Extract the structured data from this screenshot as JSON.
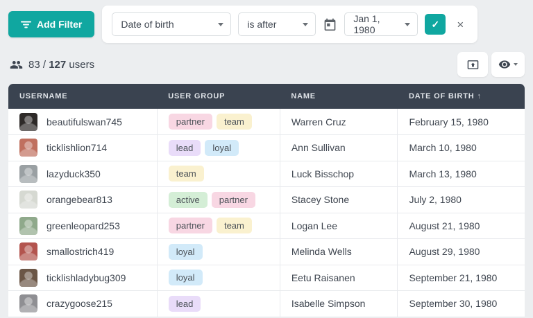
{
  "filter_bar": {
    "add_filter_label": "Add Filter",
    "field_selected": "Date of birth",
    "operator_selected": "is after",
    "value_selected": "Jan 1, 1980",
    "apply_glyph": "✓",
    "remove_glyph": "×"
  },
  "toolbar": {
    "count_current": "83",
    "count_separator": " / ",
    "count_total": "127",
    "count_suffix": " users"
  },
  "table": {
    "columns": [
      {
        "label": "USERNAME",
        "sort": ""
      },
      {
        "label": "USER GROUP",
        "sort": ""
      },
      {
        "label": "NAME",
        "sort": ""
      },
      {
        "label": "DATE OF BIRTH",
        "sort": "↑"
      }
    ],
    "rows": [
      {
        "username": "beautifulswan745",
        "avatar_color": "#2e2a28",
        "groups": [
          "partner",
          "team"
        ],
        "name": "Warren Cruz",
        "dob": "February 15, 1980"
      },
      {
        "username": "ticklishlion714",
        "avatar_color": "#c0705f",
        "groups": [
          "lead",
          "loyal"
        ],
        "name": "Ann Sullivan",
        "dob": "March 10, 1980"
      },
      {
        "username": "lazyduck350",
        "avatar_color": "#9aa0a3",
        "groups": [
          "team"
        ],
        "name": "Luck Bisschop",
        "dob": "March 13, 1980"
      },
      {
        "username": "orangebear813",
        "avatar_color": "#d6d9d2",
        "groups": [
          "active",
          "partner"
        ],
        "name": "Stacey Stone",
        "dob": "July 2, 1980"
      },
      {
        "username": "greenleopard253",
        "avatar_color": "#8fa98b",
        "groups": [
          "partner",
          "team"
        ],
        "name": "Logan Lee",
        "dob": "August 21, 1980"
      },
      {
        "username": "smallostrich419",
        "avatar_color": "#b3544e",
        "groups": [
          "loyal"
        ],
        "name": "Melinda Wells",
        "dob": "August 29, 1980"
      },
      {
        "username": "ticklishladybug309",
        "avatar_color": "#6b5646",
        "groups": [
          "loyal"
        ],
        "name": "Eetu Raisanen",
        "dob": "September 21, 1980"
      },
      {
        "username": "crazygoose215",
        "avatar_color": "#8f8f93",
        "groups": [
          "lead"
        ],
        "name": "Isabelle Simpson",
        "dob": "September 30, 1980"
      }
    ],
    "tag_colors": {
      "partner": "#f8d7e3",
      "team": "#faf1cf",
      "lead": "#e9dcf9",
      "loyal": "#d2eaf9",
      "active": "#d4eed6"
    }
  },
  "colors": {
    "accent_teal": "#10a7a0",
    "table_header_bg": "#3a4350",
    "page_bg": "#eceef0"
  }
}
